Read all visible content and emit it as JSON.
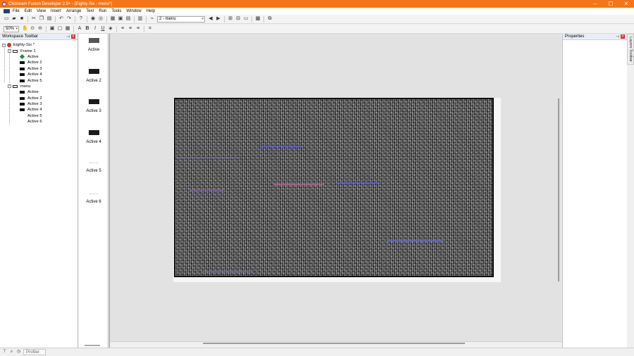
{
  "window": {
    "title": "Clickteam Fusion Developer 2.5+ - [Eighty-Six - menu*]",
    "controls": [
      "–",
      "☐",
      "✕"
    ]
  },
  "menu": [
    "File",
    "Edit",
    "View",
    "Insert",
    "Arrange",
    "Text",
    "Run",
    "Tools",
    "Window",
    "Help"
  ],
  "toolbar": {
    "frame_select": "2 - menu",
    "zoom": "50%"
  },
  "workspace": {
    "title": "Workspace Toolbar",
    "tree": {
      "root": "Eighty-Six *",
      "frames": [
        {
          "name": "Frame 1",
          "objects": [
            "Active",
            "Active 2",
            "Active 3",
            "Active 4",
            "Active 5"
          ]
        },
        {
          "name": "menu",
          "objects": [
            "Active",
            "Active 2",
            "Active 3",
            "Active 4",
            "Active 5",
            "Active 6"
          ]
        }
      ]
    }
  },
  "object_bar": {
    "items": [
      "Active",
      "Active 2",
      "Active 3",
      "Active 4",
      "Active 5",
      "Active 6"
    ]
  },
  "properties": {
    "title": "Properties"
  },
  "layers_tab": "Layers Toolbar",
  "status": {
    "tab": "Profiler"
  }
}
